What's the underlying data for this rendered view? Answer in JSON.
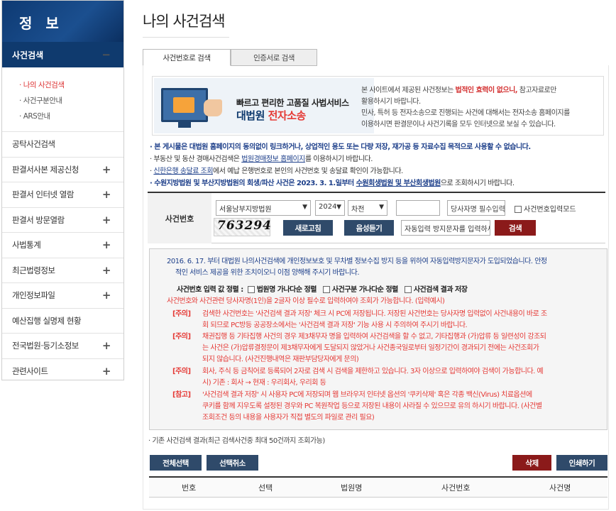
{
  "sidebar": {
    "title": "정 보",
    "active": "사건검색",
    "active_toggle": "−",
    "sub_items": [
      "나의 사건검색",
      "사건구분안내",
      "ARS안내"
    ],
    "items": [
      {
        "label": "공탁사건검색",
        "toggle": ""
      },
      {
        "label": "판결서사본 제공신청",
        "toggle": "+"
      },
      {
        "label": "판결서 인터넷 열람",
        "toggle": "+"
      },
      {
        "label": "판결서 방문열람",
        "toggle": "+"
      },
      {
        "label": "사법통계",
        "toggle": "+"
      },
      {
        "label": "최근법령정보",
        "toggle": "+"
      },
      {
        "label": "개인정보파일",
        "toggle": "+"
      },
      {
        "label": "예산집행 실명제 현황",
        "toggle": ""
      },
      {
        "label": "전국법원·등기소정보",
        "toggle": "+"
      },
      {
        "label": "관련사이트",
        "toggle": "+"
      }
    ]
  },
  "page_title": "나의 사건검색",
  "tabs": [
    "사건번호로 검색",
    "인증서로 검색"
  ],
  "banner": {
    "line1": "빠르고 편리한 고품질 사법서비스",
    "line2a": "대법원 ",
    "line2b": "전자소송",
    "text1a": "본 사이트에서 제공된 사건정보는 ",
    "text1b": "법적인 효력이 없으니,",
    "text1c": " 참고자료로만",
    "text2": "활용하시기 바랍니다.",
    "text3": "민사, 특허 등 전자소송으로 진행되는 사건에 대해서는 전자소송 홈페이지를",
    "text4": "이용하시면 판결문이나 사건기록을 모두 인터넷으로 보실 수 있습니다."
  },
  "notices": {
    "n1": "본 게시물은 대법원 홈페이지의 동의없이 링크하거나, 상업적인 용도 또는 다량 저장, 재가공 등 자료수집 목적으로 사용할 수 없습니다.",
    "n2a": "부동산 및 동산 경매사건검색은 ",
    "n2b": "법원경매정보 홈페이지",
    "n2c": "를 이용하시기 바랍니다.",
    "n3a": "신한은행 송달료 조회",
    "n3b": "에서 예납 은행번호로 본인의 사건번호 및 송달료 확인이 가능합니다.",
    "n4a": "수원지방법원 및 부산지방법원의 회생/파산 사건은 2023. 3. 1.일부터 ",
    "n4b": "수원회생법원 및 부산회생법원",
    "n4c": "으로 조회하시기 바랍니다."
  },
  "search": {
    "label": "사건번호",
    "court": "서울남부지방법원",
    "year": "2024",
    "case_type": "차전",
    "case_number": "",
    "party_placeholder": "당사자명 필수입력",
    "direct_input_label": "사건번호입력모드",
    "captcha_text": "763294",
    "refresh_label": "새로고침",
    "audio_label": "음성듣기",
    "captcha_placeholder": "자동입력 방지문자를 입력하세요",
    "search_label": "검색"
  },
  "warnings": {
    "w1": "2016. 6. 17. 부터 대법원 나의사건검색에 개인정보보호 및 무차별 정보수집 방지 등을 위하여 자동입력방지문자가 도입되었습니다. 안정",
    "w1b": "적인 서비스 제공을 위한 조치이오니 이점 양해해 주시기 바랍니다.",
    "sort_label": "사건번호 입력 값 정렬 :",
    "opt1": "법원명 가나다순 정렬",
    "opt2": "사건구분 가나다순 정렬",
    "opt3": "사건검색 결과 저장",
    "w2": "사건번호와 사건관련 당사자명(1인)을 2글자 이상 필수로 입력하여야 조회가 가능합니다. (입력예시)",
    "c1_tag": "[주의]",
    "c1_a": "검색한 사건번호는 '사건검색 결과 저장' 체크 시 PC에 저장됩니다. 저장된 사건번호는 당사자명 입력없이 사건내용이 바로 조",
    "c1_b": "회 되므로 PC방등 공공장소에서는 '사건검색 결과 저장' 기능 사용 시 주의하여 주시기 바랍니다.",
    "c2_tag": "[주의]",
    "c2_a": "채권집행 등 기타집행 사건의 경우 제3채무자 명을 입력하여 사건검색을 할 수 없고, 기타집행과 (가)압류 등 일련성이 강조되",
    "c2_b": "는 사건은 (가)압류결정문이 제3채무자에게 도달되지 않았거나 사건종국일로부터 일정기간이 경과되기 전에는 사건조회가",
    "c2_c": "되지 않습니다. (사건진행내역은 재판부담당자에게 문의)",
    "c3_tag": "[주의]",
    "c3_a": "회사, 주식 등 금칙어로 등록되어 2자로 검색 시 검색을 제한하고 있습니다. 3자 이상으로 입력하여야 검색이 가능합니다. 예",
    "c3_b": "시) 기존 : 회사 → 현재 : 우리회사, 우리회 등",
    "c4_tag": "[참고]",
    "c4_a": "'사건검색 결과 저장' 시 사용자 PC에 저장되며 웹 브라우저 인터넷 옵션의 '쿠키삭제' 혹은 각종 백신(Virus) 치료옵션에",
    "c4_b": "쿠키를 함께 지우도록 설정된 경우와 PC 복원작업 등으로 저장된 내용이 사라질 수 있으므로 유의 하시기 바랍니다. (사건별",
    "c4_c": "조회조건 등의 내용을 사용자가 직접 별도의 파일로 관리 필요)"
  },
  "results": {
    "note": "기존 사건검색 결과(최근 검색사건중 최대 50건까지 조회가능)",
    "select_all": "전체선택",
    "deselect": "선택취소",
    "delete": "삭제",
    "print": "인쇄하기",
    "columns": [
      "번호",
      "선택",
      "법원명",
      "사건번호",
      "사건명"
    ]
  },
  "colors": {
    "navy": "#0f3a6e",
    "button_navy": "#2f4a6a",
    "button_red": "#8b1a1a",
    "warning_red": "#e53935",
    "notice_blue": "#1d3f8a"
  }
}
